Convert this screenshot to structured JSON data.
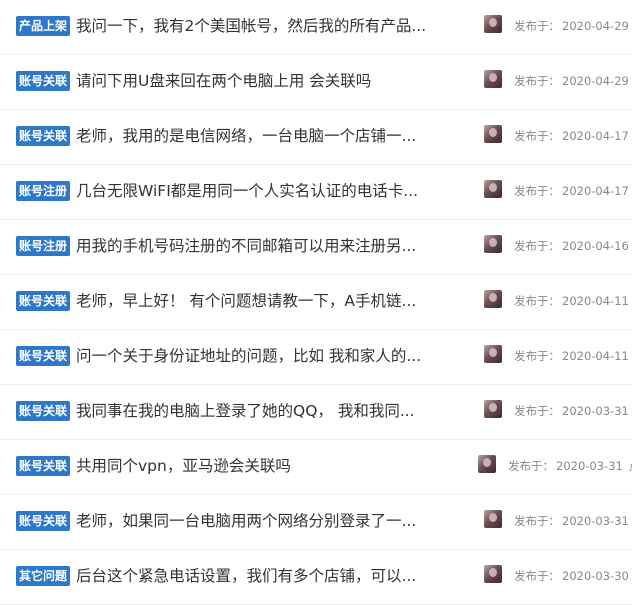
{
  "posts": [
    {
      "tag": "产品上架",
      "title": "我问一下，我有2个美国帐号，然后我的所有产品...",
      "posted_label": "发布于：",
      "date": "2020-04-29",
      "extra": ""
    },
    {
      "tag": "账号关联",
      "title": "请问下用U盘来回在两个电脑上用 会关联吗",
      "posted_label": "发布于：",
      "date": "2020-04-29",
      "extra": ""
    },
    {
      "tag": "账号关联",
      "title": "老师，我用的是电信网络，一台电脑一个店铺一...",
      "posted_label": "发布于：",
      "date": "2020-04-17",
      "extra": ""
    },
    {
      "tag": "账号注册",
      "title": "几台无限WiFI都是用同一个人实名认证的电话卡...",
      "posted_label": "发布于：",
      "date": "2020-04-17",
      "extra": ""
    },
    {
      "tag": "账号注册",
      "title": "用我的手机号码注册的不同邮箱可以用来注册另...",
      "posted_label": "发布于：",
      "date": "2020-04-16",
      "extra": ""
    },
    {
      "tag": "账号关联",
      "title": "老师，早上好！ 有个问题想请教一下，A手机链...",
      "posted_label": "发布于：",
      "date": "2020-04-11",
      "extra": ""
    },
    {
      "tag": "账号关联",
      "title": "问一个关于身份证地址的问题，比如 我和家人的...",
      "posted_label": "发布于：",
      "date": "2020-04-11",
      "extra": ""
    },
    {
      "tag": "账号关联",
      "title": "我同事在我的电脑上登录了她的QQ， 我和我同...",
      "posted_label": "发布于：",
      "date": "2020-03-31",
      "extra": ""
    },
    {
      "tag": "账号关联",
      "title": "共用同个vpn，亚马逊会关联吗",
      "posted_label": "发布于：",
      "date": "2020-03-31",
      "extra": "点"
    },
    {
      "tag": "账号关联",
      "title": "老师，如果同一台电脑用两个网络分别登录了一...",
      "posted_label": "发布于：",
      "date": "2020-03-31",
      "extra": ""
    },
    {
      "tag": "其它问题",
      "title": "后台这个紧急电话设置，我们有多个店铺，可以...",
      "posted_label": "发布于：",
      "date": "2020-03-30",
      "extra": ""
    }
  ]
}
